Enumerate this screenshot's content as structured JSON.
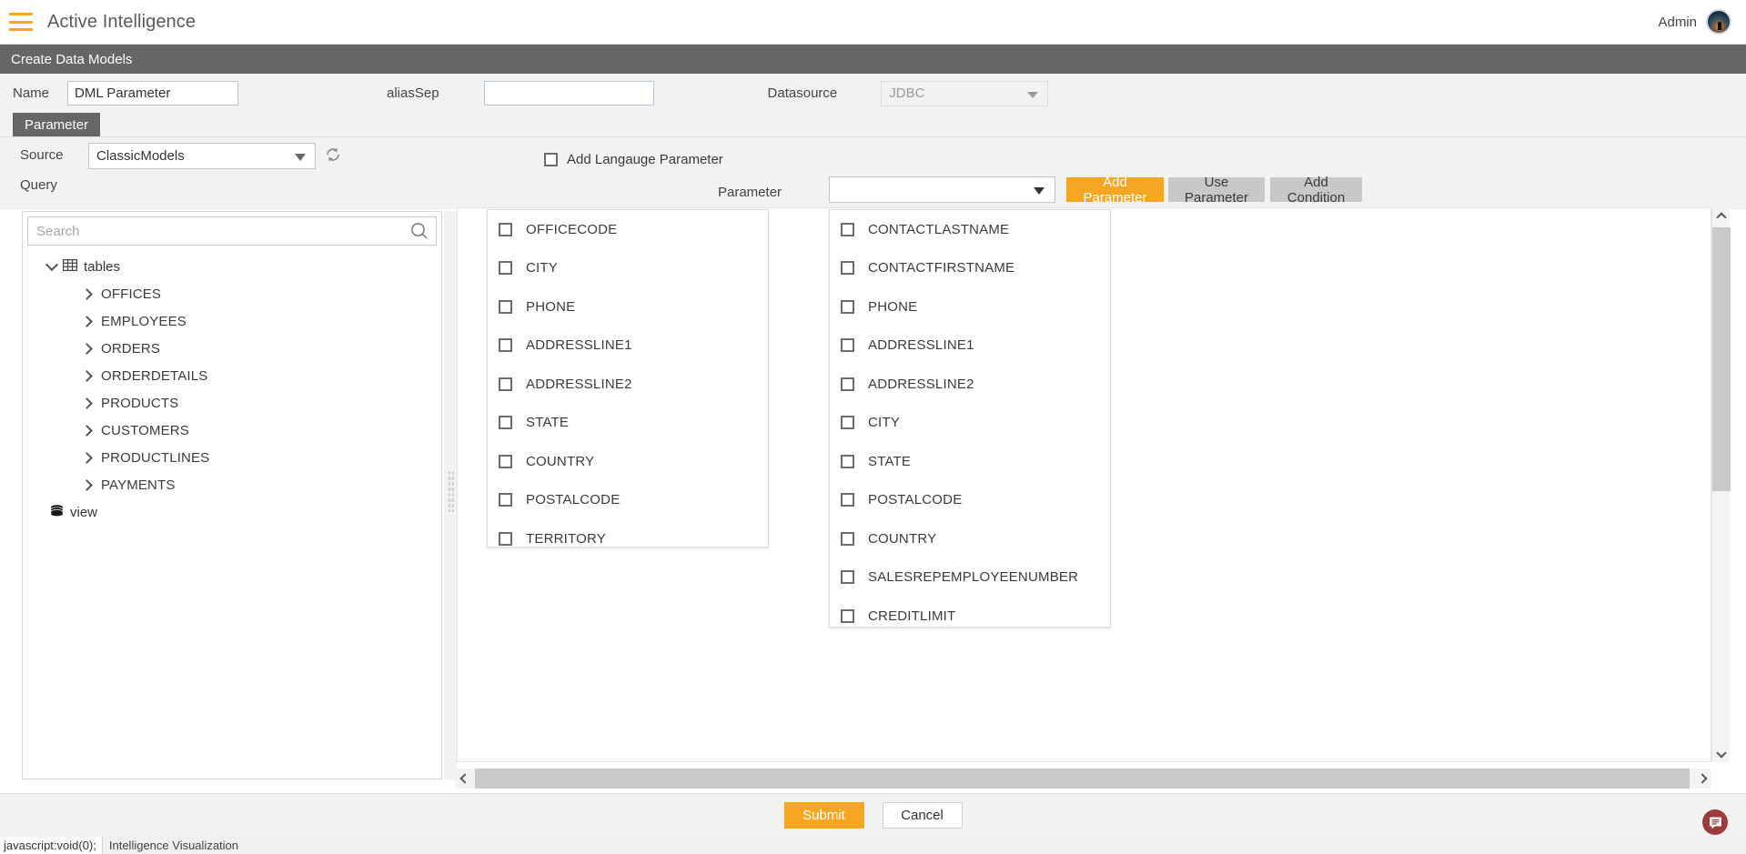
{
  "appbar": {
    "menu_icon": "hamburger-icon",
    "title": "Active Intelligence",
    "user_name": "Admin",
    "avatar_icon": "user-avatar"
  },
  "page_header": {
    "title": "Create Data Models"
  },
  "form": {
    "name_label": "Name",
    "name_value": "DML Parameter",
    "name_placeholder": "",
    "aliassep_label": "aliasSep",
    "aliassep_value": "",
    "aliassep_placeholder": "",
    "datasource_label": "Datasource",
    "datasource_value": "JDBC"
  },
  "tabs": [
    {
      "label": "Parameter",
      "active": true
    }
  ],
  "parameter_panel": {
    "source_label": "Source",
    "source_value": "ClassicModels",
    "refresh_icon": "refresh-icon",
    "query_label": "Query",
    "add_language_parameter_label": "Add Langauge Parameter",
    "add_language_parameter_checked": false,
    "parameter_label": "Parameter",
    "parameter_value": "",
    "buttons": {
      "add_parameter": "Add Parameter",
      "use_parameter": "Use Parameter",
      "add_condition": "Add Condition"
    }
  },
  "tree_panel": {
    "search_placeholder": "Search",
    "search_value": "",
    "search_icon": "search-icon",
    "root": {
      "label": "tables",
      "icon": "table-grid-icon",
      "expanded": true,
      "children": [
        {
          "label": "OFFICES"
        },
        {
          "label": "EMPLOYEES"
        },
        {
          "label": "ORDERS"
        },
        {
          "label": "ORDERDETAILS"
        },
        {
          "label": "PRODUCTS"
        },
        {
          "label": "CUSTOMERS"
        },
        {
          "label": "PRODUCTLINES"
        },
        {
          "label": "PAYMENTS"
        }
      ]
    },
    "view_node": {
      "label": "view",
      "icon": "database-icon"
    }
  },
  "canvas": {
    "cards": [
      {
        "name": "offices-field-card",
        "fields": [
          {
            "label": "OFFICECODE",
            "checked": false
          },
          {
            "label": "CITY",
            "checked": false
          },
          {
            "label": "PHONE",
            "checked": false
          },
          {
            "label": "ADDRESSLINE1",
            "checked": false
          },
          {
            "label": "ADDRESSLINE2",
            "checked": false
          },
          {
            "label": "STATE",
            "checked": false
          },
          {
            "label": "COUNTRY",
            "checked": false
          },
          {
            "label": "POSTALCODE",
            "checked": false
          },
          {
            "label": "TERRITORY",
            "checked": false
          }
        ]
      },
      {
        "name": "customers-field-card",
        "fields": [
          {
            "label": "CONTACTLASTNAME",
            "checked": false
          },
          {
            "label": "CONTACTFIRSTNAME",
            "checked": false
          },
          {
            "label": "PHONE",
            "checked": false
          },
          {
            "label": "ADDRESSLINE1",
            "checked": false
          },
          {
            "label": "ADDRESSLINE2",
            "checked": false
          },
          {
            "label": "CITY",
            "checked": false
          },
          {
            "label": "STATE",
            "checked": false
          },
          {
            "label": "POSTALCODE",
            "checked": false
          },
          {
            "label": "COUNTRY",
            "checked": false
          },
          {
            "label": "SALESREPEMPLOYEENUMBER",
            "checked": false
          },
          {
            "label": "CREDITLIMIT",
            "checked": false
          }
        ]
      }
    ]
  },
  "footer": {
    "submit_label": "Submit",
    "cancel_label": "Cancel",
    "feedback_icon": "feedback-chat-icon"
  },
  "statusbar": {
    "link_text": "javascript:void(0);",
    "text": "Intelligence Visualization"
  },
  "colors": {
    "accent": "#f5a623",
    "header_band": "#666666",
    "panel_bg": "#f2f2f2",
    "button_grey": "#c8c8c8",
    "feedback_red": "#9b3b3b"
  }
}
